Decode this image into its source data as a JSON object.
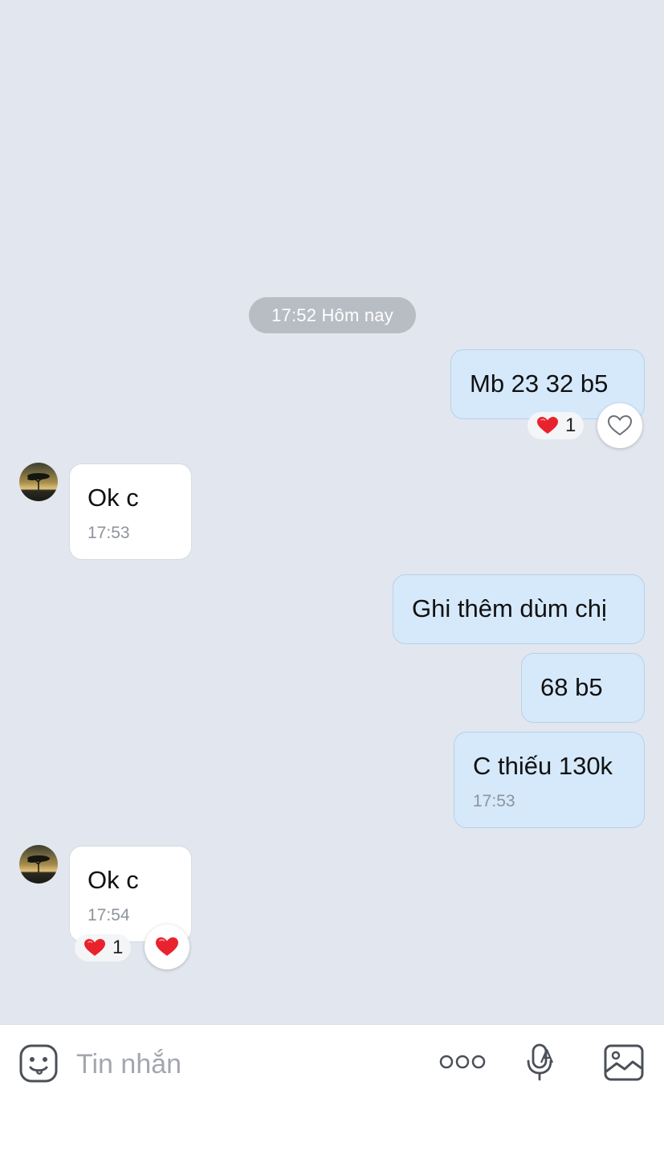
{
  "chat": {
    "date_divider": "17:52 Hôm nay",
    "messages": [
      {
        "side": "out",
        "text": "Mb 23 32 b5",
        "reaction_count": "1"
      },
      {
        "side": "in",
        "text": "Ok c",
        "time": "17:53"
      },
      {
        "side": "out",
        "text": "Ghi thêm dùm chị"
      },
      {
        "side": "out",
        "text": "68 b5"
      },
      {
        "side": "out",
        "text": "C thiếu 130k",
        "time": "17:53"
      },
      {
        "side": "in",
        "text": "Ok c",
        "time": "17:54",
        "reaction_count": "1"
      }
    ]
  },
  "composer": {
    "placeholder": "Tin nhắn",
    "icons": [
      "sticker-icon",
      "more-icon",
      "voice-to-text-icon",
      "image-icon"
    ]
  },
  "colors": {
    "background": "#e2e6ee",
    "outgoing_bubble": "#d5e9fb",
    "incoming_bubble": "#ffffff",
    "heart": "#e8232e"
  }
}
